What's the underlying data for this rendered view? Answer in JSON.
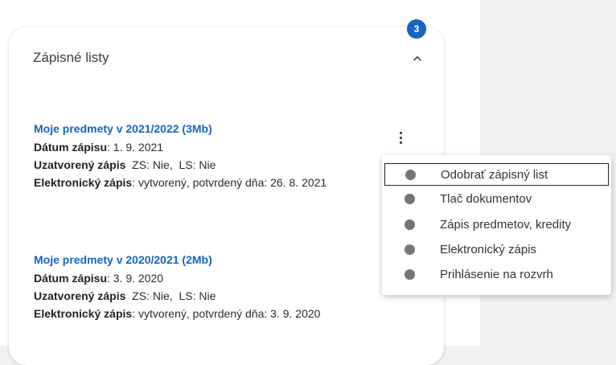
{
  "card": {
    "title": "Zápisné listy",
    "badge": "3"
  },
  "entries": [
    {
      "title": "Moje predmety v 2021/2022 (3Mb)",
      "datum_label": "Dátum zápisu",
      "datum_value": ": 1. 9. 2021",
      "uzatvoreny_label": "Uzatvorený zápis",
      "uzatvoreny_value": "  ZS: Nie,  LS: Nie",
      "elektronicky_label": "Elektronický zápis",
      "elektronicky_value": ": vytvorený, potvrdený dňa: 26. 8. 2021"
    },
    {
      "title": "Moje predmety v 2020/2021 (2Mb)",
      "datum_label": "Dátum zápisu",
      "datum_value": ": 3. 9. 2020",
      "uzatvoreny_label": "Uzatvorený zápis",
      "uzatvoreny_value": "  ZS: Nie,  LS: Nie",
      "elektronicky_label": "Elektronický zápis",
      "elektronicky_value": ": vytvorený, potvrdený dňa: 3. 9. 2020"
    }
  ],
  "menu": {
    "items": [
      {
        "label": "Odobrať zápisný list"
      },
      {
        "label": "Tlač dokumentov"
      },
      {
        "label": "Zápis predmetov, kredity"
      },
      {
        "label": "Elektronický zápis"
      },
      {
        "label": "Prihlásenie na rozvrh"
      }
    ]
  },
  "icons": {
    "collapse": "chevron-up-icon",
    "kebab": "more-vert-icon",
    "menu_item": "circle-icon"
  },
  "colors": {
    "link": "#1565c0",
    "badge": "#1565c0",
    "dot": "#757575"
  }
}
